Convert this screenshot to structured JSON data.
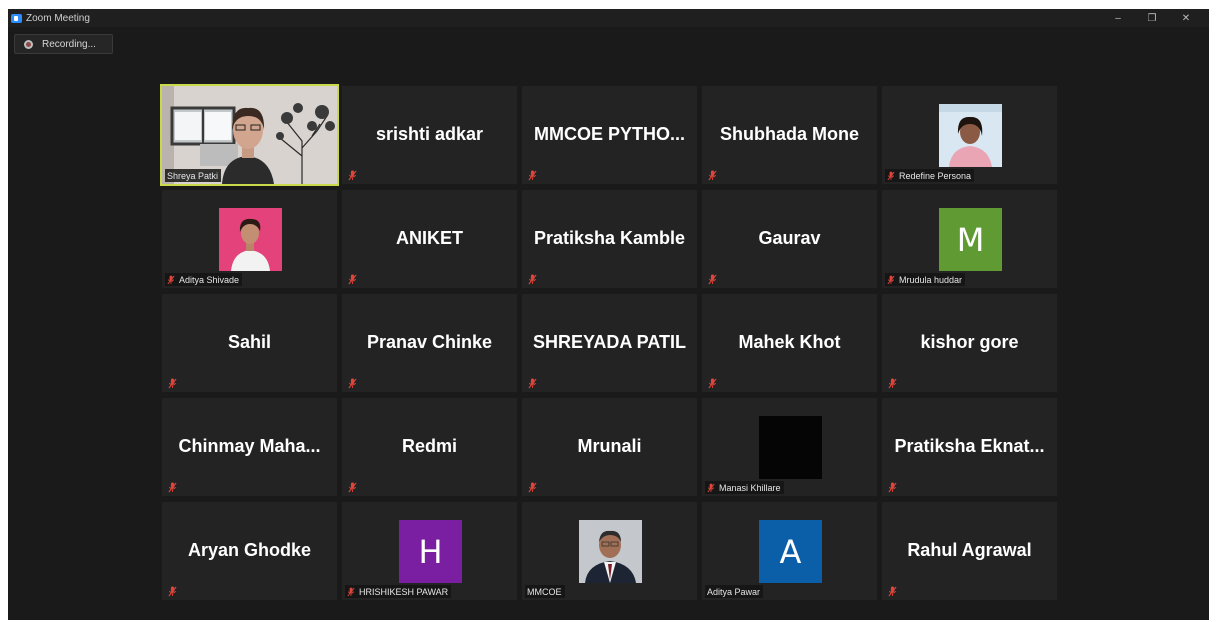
{
  "window": {
    "title": "Zoom Meeting",
    "controls": [
      "–",
      "❐",
      "✕"
    ]
  },
  "recording": {
    "label": "Recording..."
  },
  "colors": {
    "active_border": "#c9d94a",
    "avatar_green": "#5f9b32",
    "avatar_purple": "#7a1fa2",
    "avatar_blue": "#0b5ea8",
    "mute_red": "#e0443a"
  },
  "participants": [
    {
      "kind": "video",
      "caption": "Shreya Patki",
      "muted": false,
      "active": true
    },
    {
      "kind": "name",
      "name": "srishti adkar",
      "muted": true
    },
    {
      "kind": "name",
      "name": "MMCOE  PYTHO...",
      "muted": true
    },
    {
      "kind": "name",
      "name": "Shubhada Mone",
      "muted": true
    },
    {
      "kind": "photo",
      "caption": "Redefine Persona",
      "muted": true
    },
    {
      "kind": "photo",
      "caption": "Aditya Shivade",
      "muted": true
    },
    {
      "kind": "name",
      "name": "ANIKET",
      "muted": true
    },
    {
      "kind": "name",
      "name": "Pratiksha Kamble",
      "muted": true
    },
    {
      "kind": "name",
      "name": "Gaurav",
      "muted": true
    },
    {
      "kind": "letter",
      "letter": "M",
      "caption": "Mrudula huddar",
      "muted": true,
      "color": "#5f9b32"
    },
    {
      "kind": "name",
      "name": "Sahil",
      "muted": true
    },
    {
      "kind": "name",
      "name": "Pranav Chinke",
      "muted": true
    },
    {
      "kind": "name",
      "name": "SHREYADA PATIL",
      "muted": true
    },
    {
      "kind": "name",
      "name": "Mahek Khot",
      "muted": true
    },
    {
      "kind": "name",
      "name": "kishor gore",
      "muted": true
    },
    {
      "kind": "name",
      "name": "Chinmay  Maha...",
      "muted": true
    },
    {
      "kind": "name",
      "name": "Redmi",
      "muted": true
    },
    {
      "kind": "name",
      "name": "Mrunali",
      "muted": true
    },
    {
      "kind": "blank",
      "caption": "Manasi Khillare",
      "muted": true
    },
    {
      "kind": "name",
      "name": "Pratiksha  Eknat...",
      "muted": true
    },
    {
      "kind": "name",
      "name": "Aryan Ghodke",
      "muted": true
    },
    {
      "kind": "letter",
      "letter": "H",
      "caption": "HRISHIKESH PAWAR",
      "muted": true,
      "color": "#7a1fa2"
    },
    {
      "kind": "photo",
      "caption": "MMCOE",
      "muted": false
    },
    {
      "kind": "letter",
      "letter": "A",
      "caption": "Aditya Pawar",
      "muted": false,
      "color": "#0b5ea8"
    },
    {
      "kind": "name",
      "name": "Rahul Agrawal",
      "muted": true
    }
  ]
}
